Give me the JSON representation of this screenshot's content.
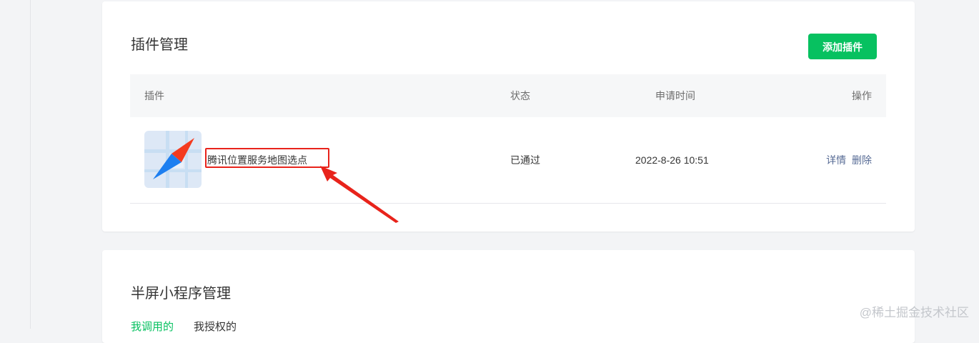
{
  "plugins_card": {
    "title": "插件管理",
    "add_button": "添加插件",
    "table": {
      "headers": {
        "plugin": "插件",
        "status": "状态",
        "time": "申请时间",
        "ops": "操作"
      },
      "rows": [
        {
          "name": "腾讯位置服务地图选点",
          "status": "已通过",
          "time": "2022-8-26 10:51",
          "ops": [
            "详情",
            "删除"
          ],
          "icon": "compass-map-icon"
        }
      ]
    }
  },
  "halfscreen_card": {
    "title": "半屏小程序管理",
    "tabs": [
      "我调用的",
      "我授权的"
    ]
  },
  "watermark": "@稀土掘金技术社区",
  "colors": {
    "primary_green": "#07c160",
    "link_blue": "#576b95",
    "annotation_red": "#e8231b",
    "header_bg": "#f6f7f8"
  }
}
